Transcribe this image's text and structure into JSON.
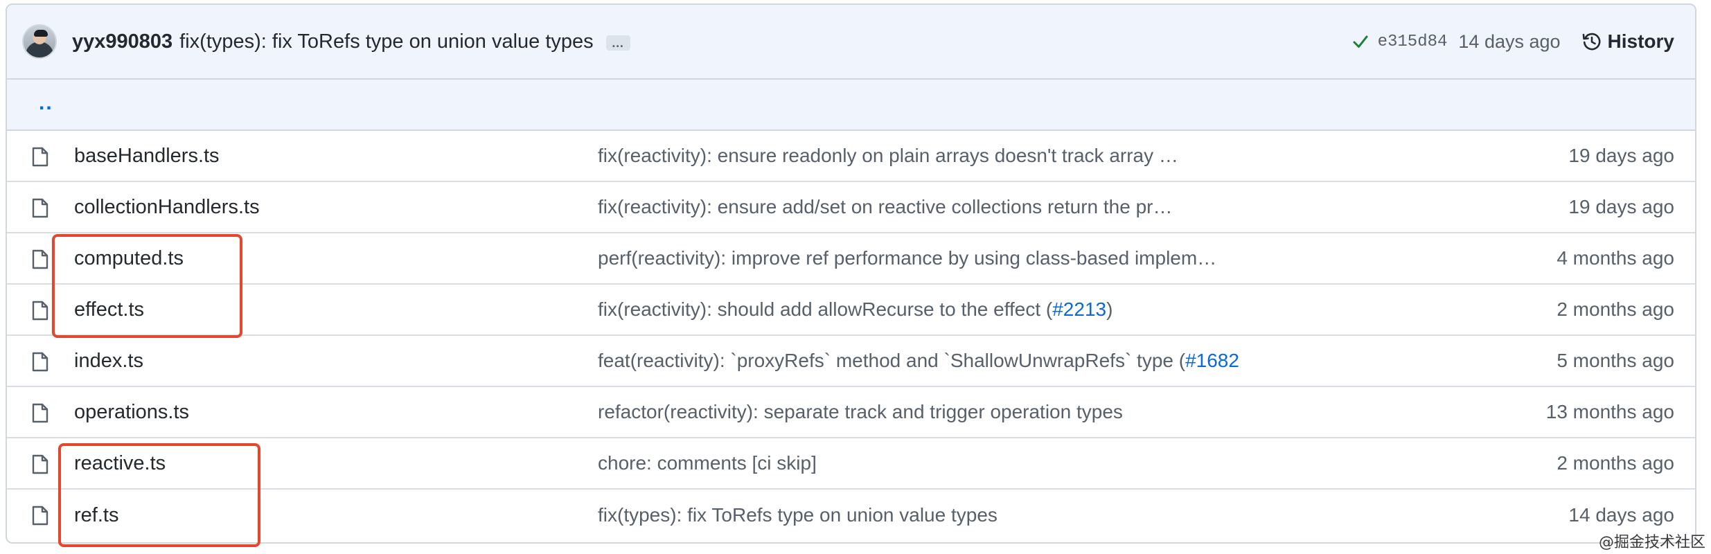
{
  "commit": {
    "author": "yyx990803",
    "message": "fix(types): fix ToRefs type on union value types",
    "ellipsis": "…",
    "sha": "e315d84",
    "age": "14 days ago",
    "history_label": "History"
  },
  "parent_link": "..",
  "files": [
    {
      "name": "baseHandlers.ts",
      "message": "fix(reactivity): ensure readonly on plain arrays doesn't track array …",
      "link": "",
      "suffix": "",
      "age": "19 days ago"
    },
    {
      "name": "collectionHandlers.ts",
      "message": "fix(reactivity): ensure add/set on reactive collections return the pr…",
      "link": "",
      "suffix": "",
      "age": "19 days ago"
    },
    {
      "name": "computed.ts",
      "message": "perf(reactivity): improve ref performance by using class-based implem…",
      "link": "",
      "suffix": "",
      "age": "4 months ago"
    },
    {
      "name": "effect.ts",
      "message": "fix(reactivity): should add allowRecurse to the effect (",
      "link": "#2213",
      "suffix": ")",
      "age": "2 months ago"
    },
    {
      "name": "index.ts",
      "message": "feat(reactivity): `proxyRefs` method and `ShallowUnwrapRefs` type (",
      "link": "#1682",
      "suffix": "",
      "age": "5 months ago"
    },
    {
      "name": "operations.ts",
      "message": "refactor(reactivity): separate track and trigger operation types",
      "link": "",
      "suffix": "",
      "age": "13 months ago"
    },
    {
      "name": "reactive.ts",
      "message": "chore: comments [ci skip]",
      "link": "",
      "suffix": "",
      "age": "2 months ago"
    },
    {
      "name": "ref.ts",
      "message": "fix(types): fix ToRefs type on union value types",
      "link": "",
      "suffix": "",
      "age": "14 days ago"
    }
  ],
  "watermark": "@掘金技术社区",
  "colors": {
    "link": "#0969da",
    "highlight": "#e4462e",
    "check": "#1a7f37",
    "header_bg": "#f0f5fd"
  },
  "icons": [
    "file-icon",
    "check-icon",
    "history-clock-icon"
  ]
}
